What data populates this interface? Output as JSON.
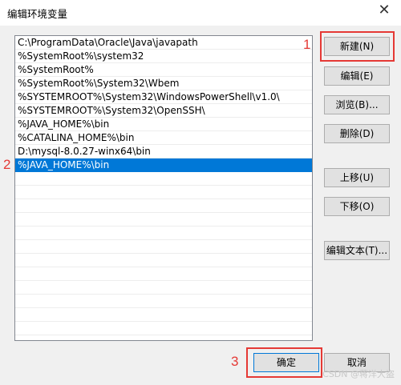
{
  "window": {
    "title": "编辑环境变量",
    "close_glyph": "✕"
  },
  "list": {
    "items": [
      "C:\\ProgramData\\Oracle\\Java\\javapath",
      "%SystemRoot%\\system32",
      "%SystemRoot%",
      "%SystemRoot%\\System32\\Wbem",
      "%SYSTEMROOT%\\System32\\WindowsPowerShell\\v1.0\\",
      "%SYSTEMROOT%\\System32\\OpenSSH\\",
      "%JAVA_HOME%\\bin",
      "%CATALINA_HOME%\\bin",
      "D:\\mysql-8.0.27-winx64\\bin",
      "%JAVA_HOME%\\bin"
    ],
    "selected_index": 9
  },
  "buttons": {
    "new": "新建(N)",
    "edit": "编辑(E)",
    "browse": "浏览(B)...",
    "delete": "删除(D)",
    "move_up": "上移(U)",
    "move_down": "下移(O)",
    "edit_text": "编辑文本(T)...",
    "ok": "确定",
    "cancel": "取消"
  },
  "annotations": {
    "one": "1",
    "two": "2",
    "three": "3"
  },
  "watermark": "CSDN @蒋洋大盗",
  "colors": {
    "selection": "#0078d7",
    "annotation_red": "#e53935"
  }
}
